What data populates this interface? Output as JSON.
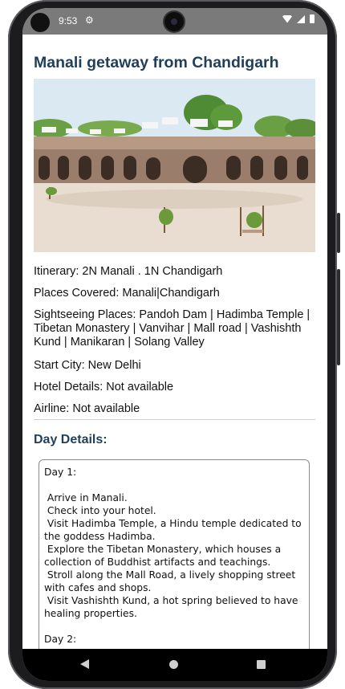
{
  "status_bar": {
    "time": "9:53",
    "icons": [
      "settings-icon",
      "wifi-icon",
      "signal-icon",
      "battery-icon"
    ]
  },
  "page": {
    "title": "Manali getaway from Chandigarh",
    "image_icon": "landmark-photo"
  },
  "info": {
    "itinerary": "Itinerary: 2N Manali . 1N Chandigarh",
    "places_covered": "Places Covered: Manali|Chandigarh",
    "sightseeing": "Sightseeing Places:  Pandoh Dam | Hadimba Temple | Tibetan Monastery | Vanvihar | Mall road | Vashishth Kund | Manikaran | Solang Valley",
    "start_city": "Start City: New Delhi",
    "hotel_details": "Hotel Details: Not available",
    "airline": "Airline: Not available"
  },
  "day_details": {
    "heading": "Day Details:",
    "text": "Day 1:\n\n Arrive in Manali.\n Check into your hotel.\n Visit Hadimba Temple, a Hindu temple dedicated to the goddess Hadimba.\n Explore the Tibetan Monastery, which houses a collection of Buddhist artifacts and teachings.\n Stroll along the Mall Road, a lively shopping street with cafes and shops.\n Visit Vashishth Kund, a hot spring believed to have healing properties.\n\nDay 2:"
  },
  "nav_bar": {
    "icons": [
      "back-icon",
      "home-icon",
      "recents-icon"
    ]
  },
  "colors": {
    "heading": "#1f3f5b",
    "status_bar": "#7a7a7a",
    "nav_bar": "#000000"
  }
}
